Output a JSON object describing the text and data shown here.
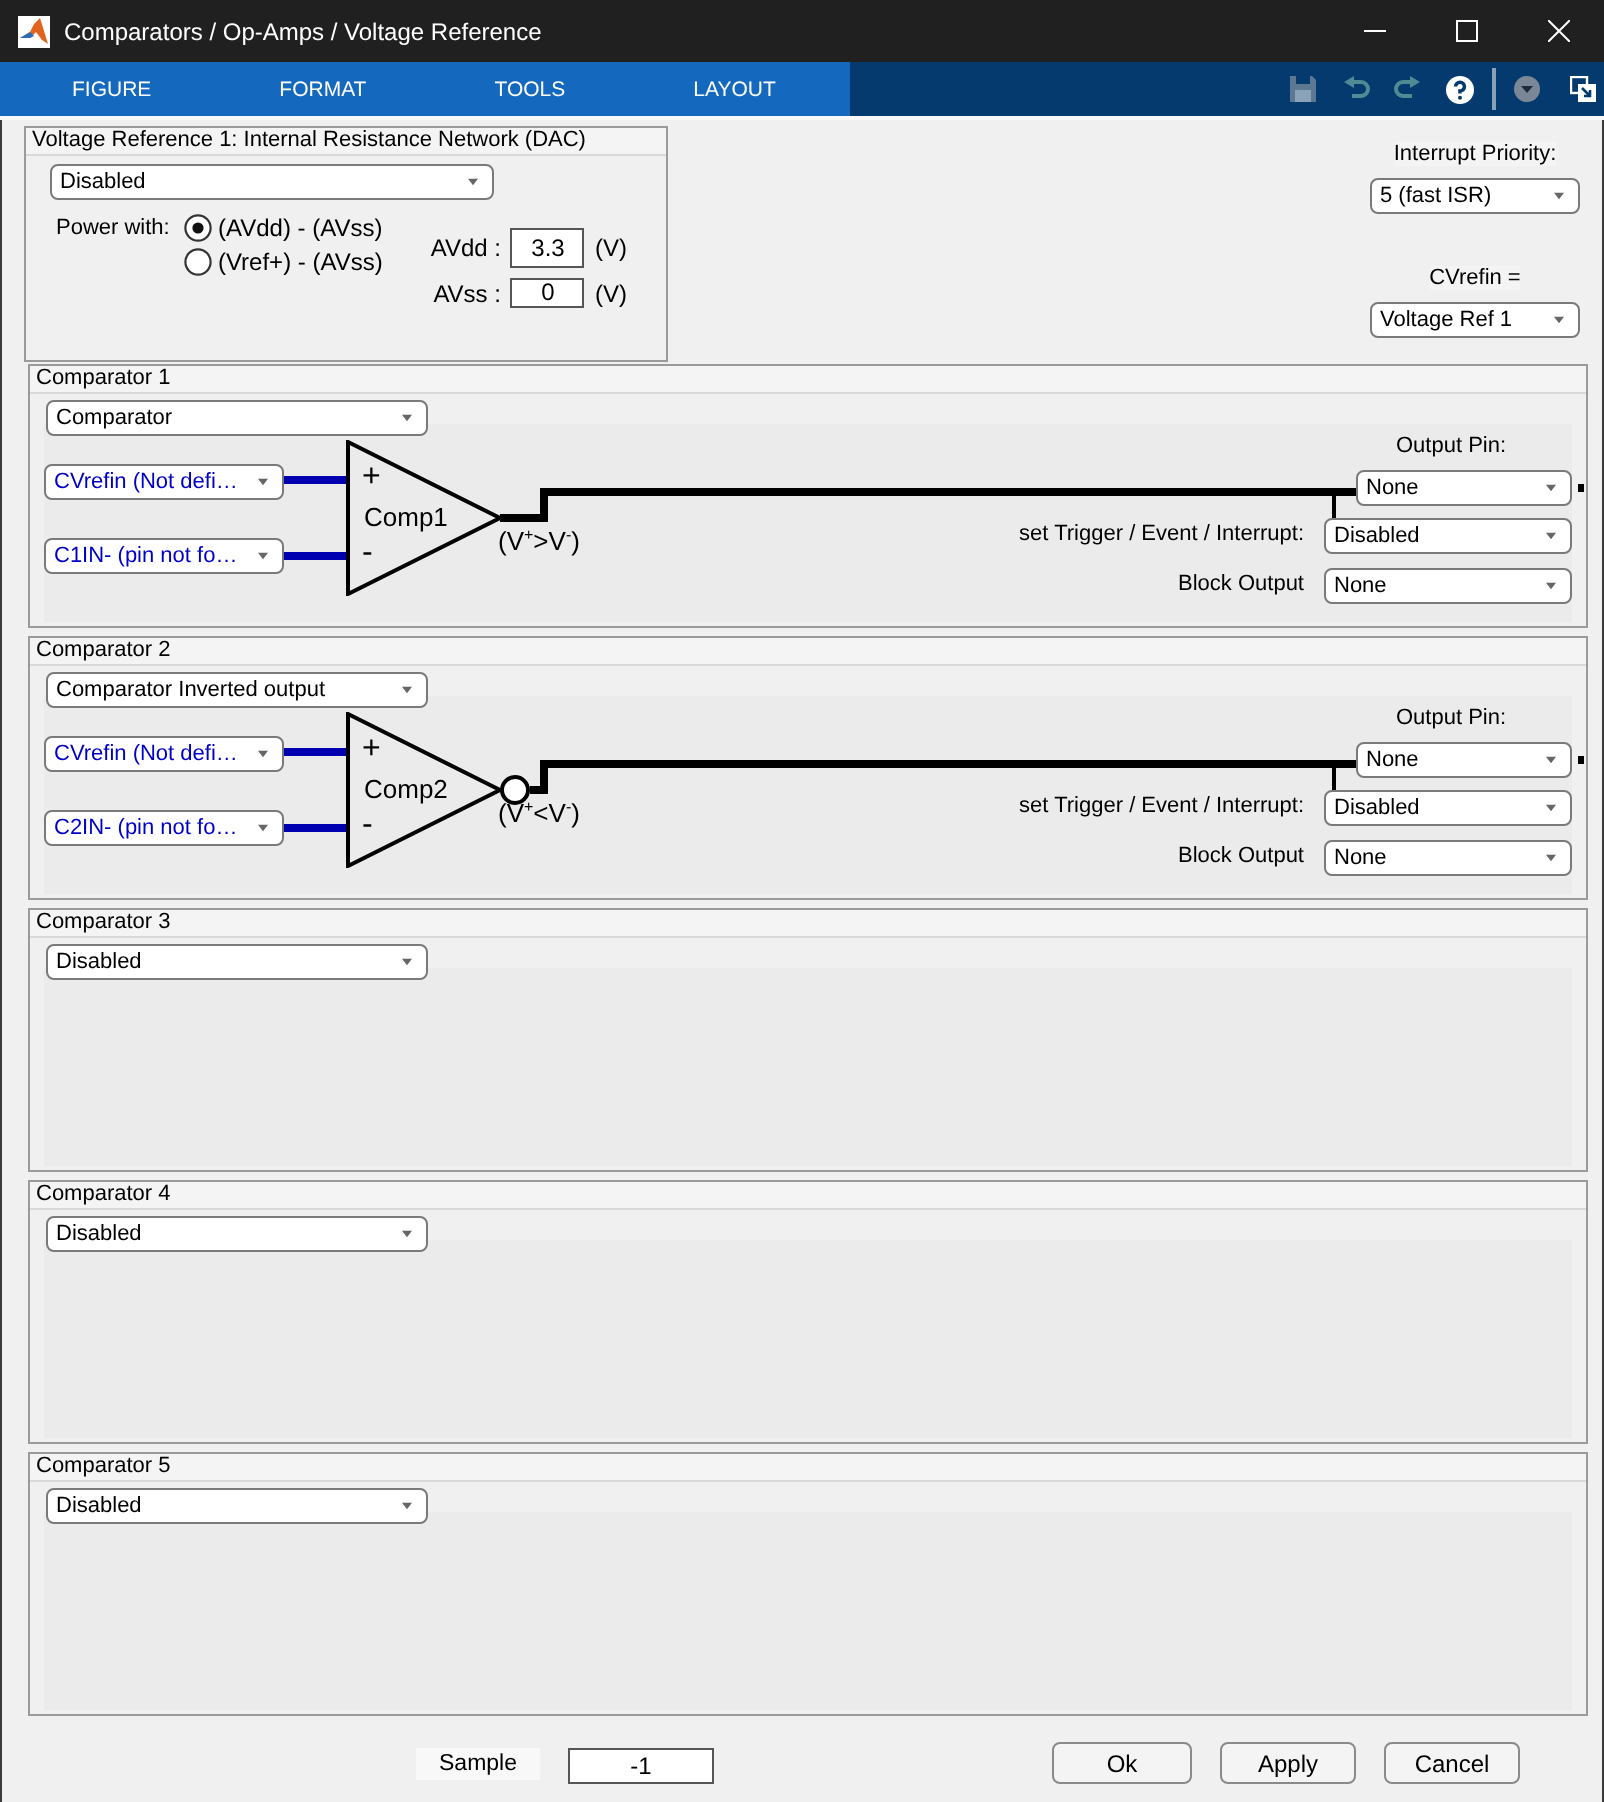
{
  "window": {
    "title": "Comparators / Op-Amps / Voltage Reference"
  },
  "toolbar": {
    "tabs": [
      {
        "label": "FIGURE",
        "selected": false
      },
      {
        "label": "FORMAT",
        "selected": false
      },
      {
        "label": "TOOLS",
        "selected": false
      },
      {
        "label": "LAYOUT",
        "selected": false
      }
    ]
  },
  "voltage_reference": {
    "title": "Voltage Reference 1: Internal Resistance Network (DAC)",
    "mode": "Disabled",
    "power_label": "Power with:",
    "power_options": [
      {
        "label": "(AVdd) - (AVss)",
        "selected": true
      },
      {
        "label": "(Vref+) - (AVss)",
        "selected": false
      }
    ],
    "supplies": [
      {
        "label": "AVdd :",
        "value": "3.3",
        "unit": "(V)"
      },
      {
        "label": "AVss :",
        "value": "0",
        "unit": "(V)"
      }
    ]
  },
  "interrupt_priority": {
    "label": "Interrupt Priority:",
    "value": "5 (fast ISR)"
  },
  "cvrefin": {
    "label": "CVrefin =",
    "value": "Voltage Ref 1"
  },
  "comparators": [
    {
      "title": "Comparator 1",
      "kind": "schematic",
      "mode": "Comparator",
      "inputs": [
        {
          "sign": "+",
          "source": "CVrefin (Not defi…"
        },
        {
          "sign": "-",
          "source": "C1IN- (pin not fo…"
        }
      ],
      "name": "Comp1",
      "inverted": false,
      "relation": "(V$^{+}$>V$^{-}$)",
      "output_pin": {
        "label": "Output Pin:",
        "value": "None"
      },
      "trigger": {
        "label": "set Trigger / Event / Interrupt:",
        "value": "Disabled"
      },
      "block_output": {
        "label": "Block Output",
        "value": "None"
      }
    },
    {
      "title": "Comparator 2",
      "kind": "schematic",
      "mode": "Comparator Inverted output",
      "inputs": [
        {
          "sign": "+",
          "source": "CVrefin (Not defi…"
        },
        {
          "sign": "-",
          "source": "C2IN- (pin not fo…"
        }
      ],
      "name": "Comp2",
      "inverted": true,
      "relation": "(V$^{+}$<V$^{-}$)",
      "output_pin": {
        "label": "Output Pin:",
        "value": "None"
      },
      "trigger": {
        "label": "set Trigger / Event / Interrupt:",
        "value": "Disabled"
      },
      "block_output": {
        "label": "Block Output",
        "value": "None"
      }
    },
    {
      "title": "Comparator 3",
      "kind": "blank",
      "mode": "Disabled"
    },
    {
      "title": "Comparator 4",
      "kind": "blank",
      "mode": "Disabled"
    },
    {
      "title": "Comparator 5",
      "kind": "blank",
      "mode": "Disabled"
    }
  ],
  "sample": {
    "label": "Sample",
    "value": "-1"
  },
  "buttons": [
    "Ok",
    "Apply",
    "Cancel"
  ]
}
